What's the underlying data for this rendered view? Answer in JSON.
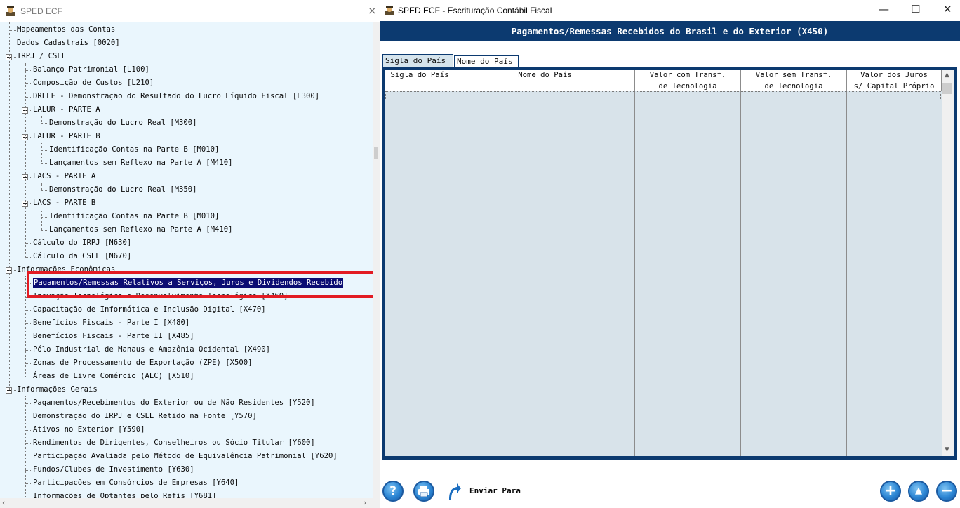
{
  "left_window": {
    "title": "SPED ECF",
    "close_glyph": "×"
  },
  "tree": [
    {
      "label": "Mapeamentos das Contas",
      "level": 0,
      "expander": false
    },
    {
      "label": "Dados Cadastrais [0020]",
      "level": 0,
      "expander": false
    },
    {
      "label": "IRPJ / CSLL",
      "level": 0,
      "expander": true
    },
    {
      "label": "Balanço Patrimonial [L100]",
      "level": 1,
      "expander": false
    },
    {
      "label": "Composição de Custos [L210]",
      "level": 1,
      "expander": false
    },
    {
      "label": "DRLLF - Demonstração do Resultado do Lucro Líquido Fiscal [L300]",
      "level": 1,
      "expander": false
    },
    {
      "label": "LALUR - PARTE A",
      "level": 1,
      "expander": true
    },
    {
      "label": "Demonstração do Lucro Real [M300]",
      "level": 2,
      "expander": false
    },
    {
      "label": "LALUR - PARTE B",
      "level": 1,
      "expander": true
    },
    {
      "label": "Identificação Contas na Parte B [M010]",
      "level": 2,
      "expander": false
    },
    {
      "label": "Lançamentos sem Reflexo na Parte A [M410]",
      "level": 2,
      "expander": false
    },
    {
      "label": "LACS - PARTE A",
      "level": 1,
      "expander": true
    },
    {
      "label": "Demonstração do Lucro Real [M350]",
      "level": 2,
      "expander": false
    },
    {
      "label": "LACS - PARTE B",
      "level": 1,
      "expander": true
    },
    {
      "label": "Identificação Contas na Parte B [M010]",
      "level": 2,
      "expander": false
    },
    {
      "label": "Lançamentos sem Reflexo na Parte A [M410]",
      "level": 2,
      "expander": false
    },
    {
      "label": "Cálculo do IRPJ [N630]",
      "level": 1,
      "expander": false
    },
    {
      "label": "Cálculo da CSLL [N670]",
      "level": 1,
      "expander": false
    },
    {
      "label": "Informações Econômicas",
      "level": 0,
      "expander": true
    },
    {
      "label": "Pagamentos/Remessas Relativos a Serviços, Juros e Dividendos Recebido",
      "level": 1,
      "expander": false,
      "selected": true
    },
    {
      "label": "Inovação Tecnológica e Desenvolvimento Tecnológico [X460]",
      "level": 1,
      "expander": false
    },
    {
      "label": "Capacitação de Informática e Inclusão Digital [X470]",
      "level": 1,
      "expander": false
    },
    {
      "label": "Benefícios Fiscais - Parte I [X480]",
      "level": 1,
      "expander": false
    },
    {
      "label": "Benefícios Fiscais - Parte II [X485]",
      "level": 1,
      "expander": false
    },
    {
      "label": "Pólo Industrial de Manaus e Amazônia Ocidental [X490]",
      "level": 1,
      "expander": false
    },
    {
      "label": "Zonas de Processamento de Exportação (ZPE) [X500]",
      "level": 1,
      "expander": false
    },
    {
      "label": "Áreas de Livre Comércio (ALC) [X510]",
      "level": 1,
      "expander": false
    },
    {
      "label": "Informações Gerais",
      "level": 0,
      "expander": true
    },
    {
      "label": "Pagamentos/Recebimentos do Exterior ou de Não Residentes [Y520]",
      "level": 1,
      "expander": false
    },
    {
      "label": "Demonstração do IRPJ e CSLL Retido na Fonte [Y570]",
      "level": 1,
      "expander": false
    },
    {
      "label": "Ativos no Exterior [Y590]",
      "level": 1,
      "expander": false
    },
    {
      "label": "Rendimentos de Dirigentes, Conselheiros ou Sócio Titular [Y600]",
      "level": 1,
      "expander": false
    },
    {
      "label": "Participação Avaliada pelo Método de Equivalência Patrimonial [Y620]",
      "level": 1,
      "expander": false
    },
    {
      "label": "Fundos/Clubes de Investimento [Y630]",
      "level": 1,
      "expander": false
    },
    {
      "label": "Participações em Consórcios de Empresas [Y640]",
      "level": 1,
      "expander": false
    },
    {
      "label": "Informações de Optantes pelo Refis [Y681]",
      "level": 1,
      "expander": false
    }
  ],
  "right_window": {
    "title": "SPED ECF  -  Escrituração Contábil Fiscal",
    "minimize_glyph": "—",
    "maximize_glyph": "☐",
    "close_glyph": "✕",
    "header": "Pagamentos/Remessas Recebidos do Brasil e do Exterior (X450)",
    "tabs": [
      "Sigla do País",
      "Nome do País"
    ],
    "columns": [
      {
        "line1": "Sigla do País",
        "line2": ""
      },
      {
        "line1": "Nome do País",
        "line2": ""
      },
      {
        "line1": "Valor com Transf.",
        "line2": "de Tecnologia"
      },
      {
        "line1": "Valor sem Transf.",
        "line2": "de Tecnologia"
      },
      {
        "line1": "Valor dos Juros",
        "line2": "s/ Capital Próprio"
      }
    ],
    "footer": {
      "help_glyph": "?",
      "enviar_label": "Enviar Para",
      "add_glyph": "+",
      "up_glyph": "▲",
      "remove_glyph": "−"
    }
  },
  "colors": {
    "header_bg": "#0c3a70",
    "selected_bg": "#0b0d73",
    "highlight_border": "#e21b23",
    "tree_bg": "#eaf6fd",
    "grid_bg": "#d8e3ea"
  },
  "icons": [
    "app-icon",
    "close-icon",
    "minimize-icon",
    "maximize-icon",
    "help-icon",
    "print-icon",
    "send-arrow-icon",
    "add-icon",
    "up-icon",
    "remove-icon"
  ]
}
